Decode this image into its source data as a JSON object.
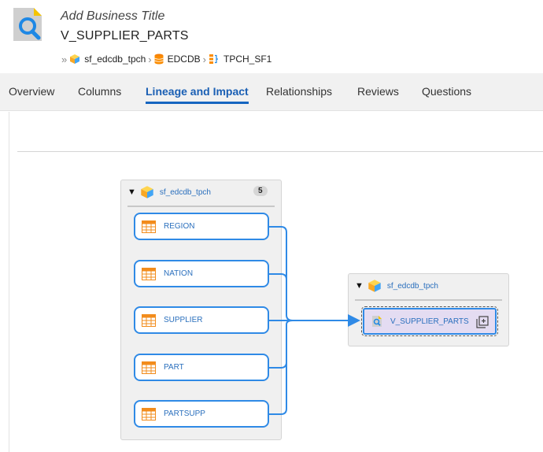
{
  "header": {
    "business_title": "Add Business Title",
    "asset_name": "V_SUPPLIER_PARTS",
    "breadcrumb": [
      {
        "label": "sf_edcdb_tpch",
        "icon": "cube-icon"
      },
      {
        "label": "EDCDB",
        "icon": "database-icon"
      },
      {
        "label": "TPCH_SF1",
        "icon": "schema-icon"
      }
    ]
  },
  "tabs": [
    {
      "label": "Overview",
      "active": false
    },
    {
      "label": "Columns",
      "active": false
    },
    {
      "label": "Lineage and Impact",
      "active": true
    },
    {
      "label": "Relationships",
      "active": false
    },
    {
      "label": "Reviews",
      "active": false
    },
    {
      "label": "Questions",
      "active": false
    }
  ],
  "lineage": {
    "source_group": {
      "name": "sf_edcdb_tpch",
      "count": "5",
      "nodes": [
        "REGION",
        "NATION",
        "SUPPLIER",
        "PART",
        "PARTSUPP"
      ]
    },
    "target_group": {
      "name": "sf_edcdb_tpch",
      "nodes": [
        "V_SUPPLIER_PARTS"
      ]
    }
  },
  "colors": {
    "accent": "#1565c0",
    "edge": "#2f8ae6",
    "table_icon": "#f28c1c",
    "target_fill": "#e4dcf2"
  }
}
